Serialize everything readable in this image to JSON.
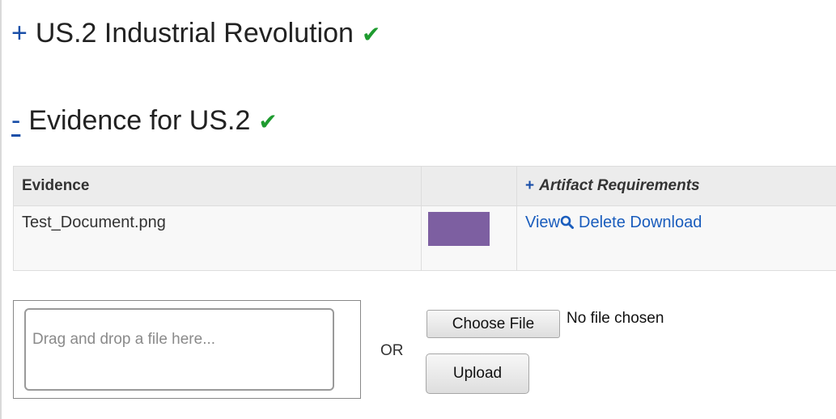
{
  "sections": [
    {
      "toggle": "+",
      "title": "US.2 Industrial Revolution",
      "status_icon": "checkmark-icon",
      "status_color": "#1e9b2f"
    },
    {
      "toggle": "-",
      "title": "Evidence for US.2",
      "status_icon": "checkmark-icon",
      "status_color": "#1e9b2f"
    }
  ],
  "table": {
    "headers": {
      "evidence": "Evidence",
      "artifact_plus": "+",
      "artifact": "Artifact Requirements"
    },
    "rows": [
      {
        "file_name": "Test_Document.png",
        "thumbnail_color": "#7d5fa1",
        "view": "View",
        "delete": "Delete",
        "download": "Download"
      }
    ]
  },
  "upload": {
    "dropzone_text": "Drag and drop a file here...",
    "or": "OR",
    "choose_file": "Choose File",
    "no_file": "No file chosen",
    "upload": "Upload"
  },
  "colors": {
    "link": "#1a5dbd",
    "toggle": "#1a4fa8",
    "check": "#1e9b2f"
  }
}
